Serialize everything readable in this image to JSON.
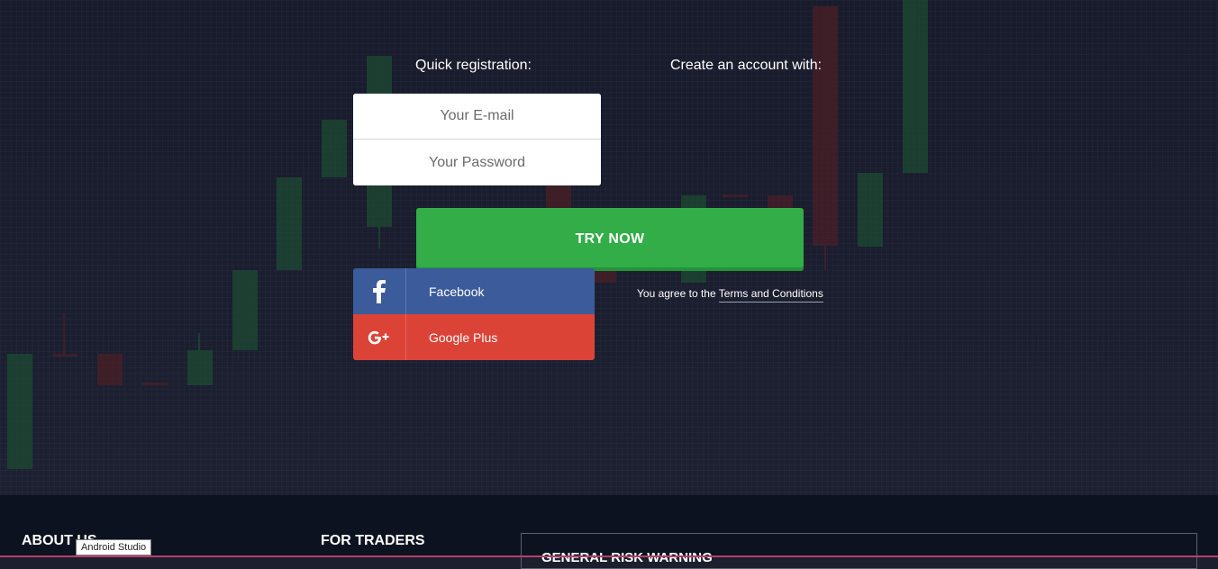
{
  "registration": {
    "quick_label": "Quick registration:",
    "create_label": "Create an account with:",
    "email_placeholder": "Your E-mail",
    "password_placeholder": "Your Password",
    "submit_label": "TRY NOW"
  },
  "social": [
    {
      "label": "Facebook",
      "icon": "facebook-icon",
      "color": "#3b5b9b"
    },
    {
      "label": "Google Plus",
      "icon": "google-plus-icon",
      "color": "#dc4337"
    }
  ],
  "terms": {
    "prefix": "You agree to the",
    "link_label": "Terms and Conditions"
  },
  "footer": {
    "about_label": "ABOUT US",
    "traders_label": "FOR TRADERS",
    "risk_label": "GENERAL RISK WARNING"
  },
  "tooltip": "Android Studio",
  "colors": {
    "accent_green": "#32ad48",
    "background": "#1b1f2e",
    "footer_bg": "#0d1220",
    "candle_up": "#1e4a32",
    "candle_down": "#4a1f26"
  }
}
